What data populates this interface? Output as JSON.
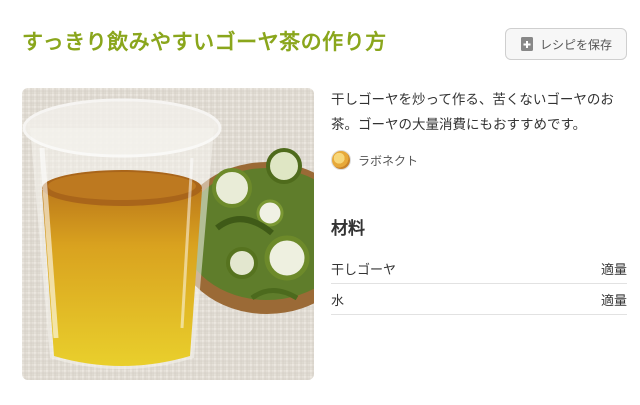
{
  "recipe": {
    "title": "すっきり飲みやすいゴーヤ茶の作り方",
    "save_label": "レシピを保存",
    "description": "干しゴーヤを炒って作る、苦くないゴーヤのお茶。ゴーヤの大量消費にもおすすめです。",
    "author": "ラボネクト"
  },
  "ingredients": {
    "heading": "材料",
    "items": [
      {
        "name": "干しゴーヤ",
        "amount": "適量"
      },
      {
        "name": "水",
        "amount": "適量"
      }
    ]
  },
  "icons": {
    "save": "bookmark-add-icon"
  },
  "colors": {
    "title": "#8aa61c"
  }
}
